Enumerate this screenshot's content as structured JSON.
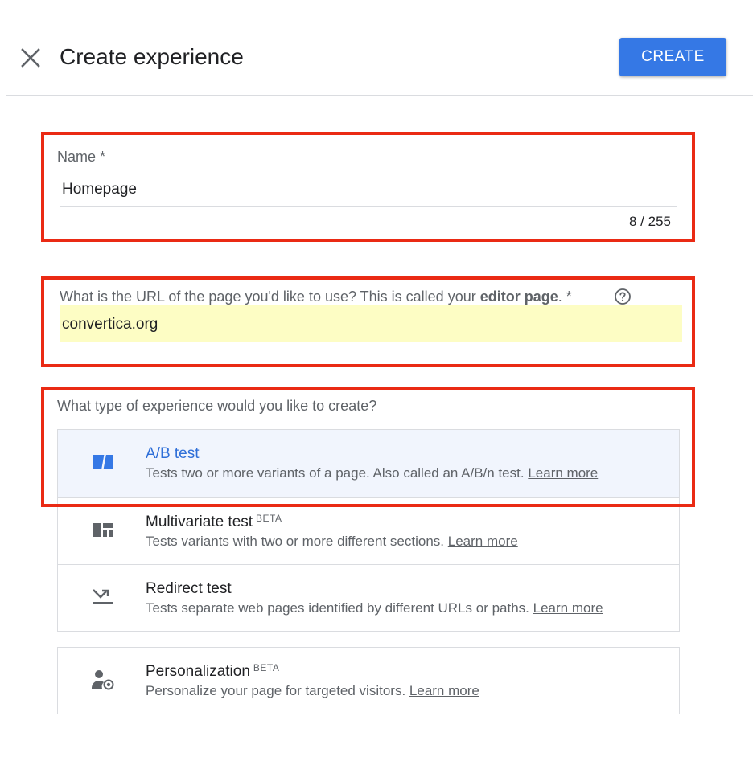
{
  "header": {
    "title": "Create experience",
    "create_label": "CREATE"
  },
  "name_field": {
    "label": "Name *",
    "value": "Homepage",
    "counter": "8 / 255"
  },
  "url_field": {
    "label_prefix": "What is the URL of the page you'd like to use? This is called your ",
    "label_bold": "editor page",
    "label_suffix": ". *",
    "value": "convertica.org"
  },
  "type_section": {
    "question": "What type of experience would you like to create?",
    "options": [
      {
        "title": "A/B test",
        "badge": "",
        "desc": "Tests two or more variants of a page. Also called an A/B/n test.",
        "link": "Learn more",
        "icon": "ab-test-icon",
        "selected": true
      },
      {
        "title": "Multivariate test",
        "badge": "BETA",
        "desc": "Tests variants with two or more different sections.",
        "link": "Learn more",
        "icon": "multivariate-icon",
        "selected": false
      },
      {
        "title": "Redirect test",
        "badge": "",
        "desc": "Tests separate web pages identified by different URLs or paths.",
        "link": "Learn more",
        "icon": "redirect-icon",
        "selected": false
      }
    ],
    "personalization": {
      "title": "Personalization",
      "badge": "BETA",
      "desc": "Personalize your page for targeted visitors.",
      "link": "Learn more",
      "icon": "personalization-icon"
    }
  },
  "colors": {
    "primary": "#3578e5",
    "highlight": "#ea2a14",
    "selected_bg": "#f1f5fd",
    "url_bg": "#fdfdc4"
  }
}
